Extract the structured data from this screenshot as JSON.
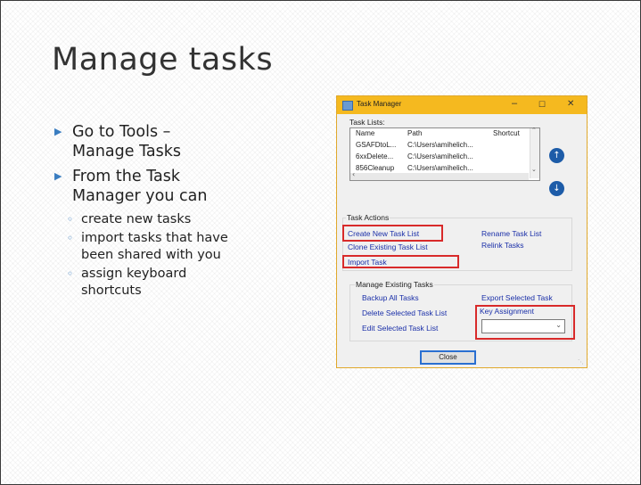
{
  "slide": {
    "title": "Manage tasks",
    "bullets": [
      {
        "text": "Go to Tools –"
      },
      {
        "text": "Manage Tasks"
      },
      {
        "text": "From the Task"
      },
      {
        "text": "Manager you can"
      }
    ],
    "sub_bullets": [
      "create new tasks",
      "import tasks that have",
      "been shared with you",
      "assign keyboard",
      "shortcuts"
    ]
  },
  "window": {
    "title": "Task Manager",
    "controls": {
      "minimize": "–",
      "maximize": "☐",
      "close": "✕"
    },
    "task_lists_label": "Task Lists:",
    "columns": [
      "Name",
      "Path",
      "Shortcut"
    ],
    "rows": [
      {
        "name": "GSAFDtoL...",
        "path": "C:\\Users\\amihelich..."
      },
      {
        "name": "6xxDelete...",
        "path": "C:\\Users\\amihelich..."
      },
      {
        "name": "856Cleanup",
        "path": "C:\\Users\\amihelich..."
      }
    ],
    "move_up_icon": "arrow-up",
    "move_down_icon": "arrow-down",
    "task_actions": {
      "label": "Task Actions",
      "create": "Create New Task List",
      "clone": "Clone Existing Task List",
      "import": "Import Task",
      "rename": "Rename Task List",
      "relink": "Relink Tasks"
    },
    "manage_existing": {
      "label": "Manage Existing Tasks",
      "backup": "Backup All Tasks",
      "delete": "Delete Selected Task List",
      "edit": "Edit Selected Task List",
      "export": "Export Selected Task",
      "key_assignment": "Key Assignment",
      "key_value": ""
    },
    "close_label": "Close"
  },
  "colors": {
    "titlebar": "#f5b91f",
    "link": "#1a2fa8",
    "highlight": "#d82a2a",
    "bullet_accent": "#3a7dc0"
  }
}
